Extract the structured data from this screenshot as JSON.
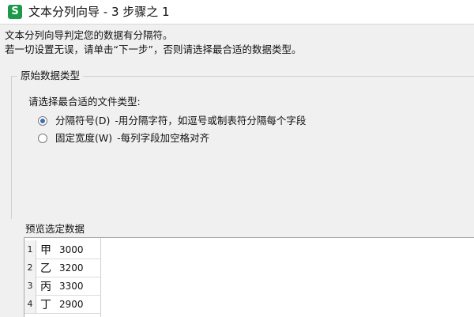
{
  "window": {
    "icon_letter": "S",
    "title": "文本分列向导 - 3 步骤之 1"
  },
  "intro": {
    "line1": "文本分列向导判定您的数据有分隔符。",
    "line2": "若一切设置无误，请单击“下一步”，否则请选择最合适的数据类型。"
  },
  "original_type": {
    "legend": "原始数据类型",
    "prompt": "请选择最合适的文件类型:",
    "options": [
      {
        "label": "分隔符号(D)",
        "desc": "-用分隔字符，如逗号或制表符分隔每个字段",
        "checked": true
      },
      {
        "label": "固定宽度(W)",
        "desc": "-每列字段加空格对齐",
        "checked": false
      }
    ]
  },
  "preview": {
    "legend": "预览选定数据",
    "rows": [
      {
        "num": "1",
        "a": "甲",
        "b": "3000"
      },
      {
        "num": "2",
        "a": "乙",
        "b": "3200"
      },
      {
        "num": "3",
        "a": "丙",
        "b": "3300"
      },
      {
        "num": "4",
        "a": "丁",
        "b": "2900"
      }
    ]
  },
  "colors": {
    "app_icon": "#1c9a4a",
    "radio_selected": "#3b6fb8"
  }
}
